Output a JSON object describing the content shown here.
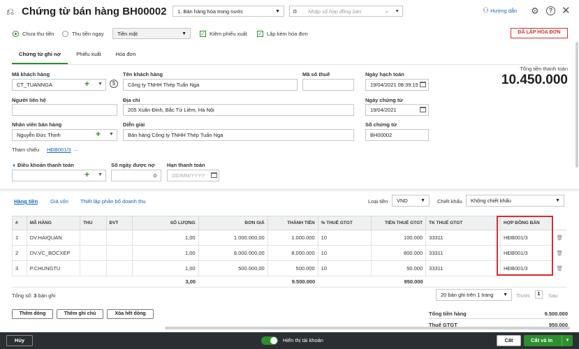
{
  "header": {
    "title": "Chứng từ bán hàng BH00002",
    "sale_type": "1. Bán hàng hóa trong nước",
    "search_placeholder": "Nhập số hợp đồng bán",
    "help_label": "Hướng dẫn"
  },
  "options": {
    "radio_unpaid": "Chưa thu tiền",
    "radio_paid": "Thu tiền ngay",
    "payment_method": "Tiền mặt",
    "chk_warehouse": "Kiêm phiếu xuất",
    "chk_invoice": "Lập kèm hóa đơn",
    "status_badge": "ĐÃ LẬP HÓA ĐƠN"
  },
  "tabs": [
    "Chứng từ ghi nợ",
    "Phiếu xuất",
    "Hóa đơn"
  ],
  "total": {
    "label": "Tổng tiền thanh toán",
    "value": "10.450.000"
  },
  "form": {
    "customer_code_label": "Mã khách hàng",
    "customer_code": "CT_TUANNGA",
    "customer_name_label": "Tên khách hàng",
    "customer_name": "Công ty TNHH Thép Tuấn Nga",
    "tax_code_label": "Mã số thuế",
    "tax_code": "",
    "posting_date_label": "Ngày hạch toán",
    "posting_date": "19/04/2021 08:39:15",
    "contact_label": "Người liên hệ",
    "contact": "",
    "address_label": "Địa chỉ",
    "address": "205 Xuân Đỉnh, Bắc Từ Liêm, Hà Nội",
    "voucher_date_label": "Ngày chứng từ",
    "voucher_date": "19/04/2021",
    "salesperson_label": "Nhân viên bán hàng",
    "salesperson": "Nguyễn Đức Thịnh",
    "description_label": "Diễn giải",
    "description": "Bán hàng Công ty TNHH Thép Tuấn Nga",
    "voucher_no_label": "Số chứng từ",
    "voucher_no": "BH00002",
    "reference_label": "Tham chiếu",
    "reference": "HĐB001/3",
    "reference_more": "...",
    "payment_terms_label": "Điều khoản thanh toán",
    "payment_terms": "",
    "due_days_label": "Số ngày được nợ",
    "due_days": "0",
    "due_date_label": "Hạn thanh toán",
    "due_date_placeholder": "DD/MM/YYYY"
  },
  "detail_tabs": [
    "Hàng tiền",
    "Giá vốn",
    "Thiết lập phân bổ doanh thu"
  ],
  "currency": {
    "label": "Loại tiền",
    "value": "VND"
  },
  "discount": {
    "label": "Chiết khấu",
    "value": "Không chiết khấu"
  },
  "grid": {
    "headers": [
      "#",
      "MÃ HÀNG",
      "THU",
      "ĐVT",
      "SỐ LƯỢNG",
      "ĐƠN GIÁ",
      "THÀNH TIỀN",
      "% THUẾ GTGT",
      "TIỀN THUẾ GTGT",
      "TK THUẾ GTGT",
      "HỢP ĐỒNG BÁN"
    ],
    "rows": [
      [
        "1",
        "DV.HAIQUAN",
        "",
        "",
        "1,00",
        "1.000.000,00",
        "1.000.000",
        "10",
        "100.000",
        "33311",
        "HĐB001/3"
      ],
      [
        "2",
        "DV.VC_BOCXEP",
        "",
        "",
        "1,00",
        "8.000.000,00",
        "8.000.000",
        "10",
        "800.000",
        "33311",
        "HĐB001/3"
      ],
      [
        "3",
        "P.CHUNGTU",
        "",
        "",
        "1,00",
        "500.000,00",
        "500.000",
        "10",
        "50.000",
        "33311",
        "HĐB001/3"
      ]
    ],
    "totals": {
      "qty": "3,00",
      "amount": "9.500.000",
      "tax": "950.000"
    }
  },
  "footer": {
    "record_count_prefix": "Tổng số:",
    "record_count": "3",
    "record_count_suffix": "bản ghi",
    "page_size": "20 bản ghi trên 1 trang",
    "prev": "Trước",
    "page": "1",
    "next": "Sau",
    "add_row": "Thêm dòng",
    "add_note": "Thêm ghi chú",
    "delete_all": "Xóa hết dòng",
    "sum_label": "Tổng tiền hàng",
    "sum_value": "9.500.000",
    "vat_label": "Thuế GTGT",
    "vat_value": "950.000"
  },
  "bottom": {
    "cancel": "Hủy",
    "show_account": "Hiển thị tài khoản",
    "save": "Cất",
    "save_print": "Cất và In"
  },
  "colors": {
    "accent": "#2e8f2e",
    "link": "#1565c0",
    "danger": "#d32f2f",
    "bar": "#2b2f33"
  }
}
